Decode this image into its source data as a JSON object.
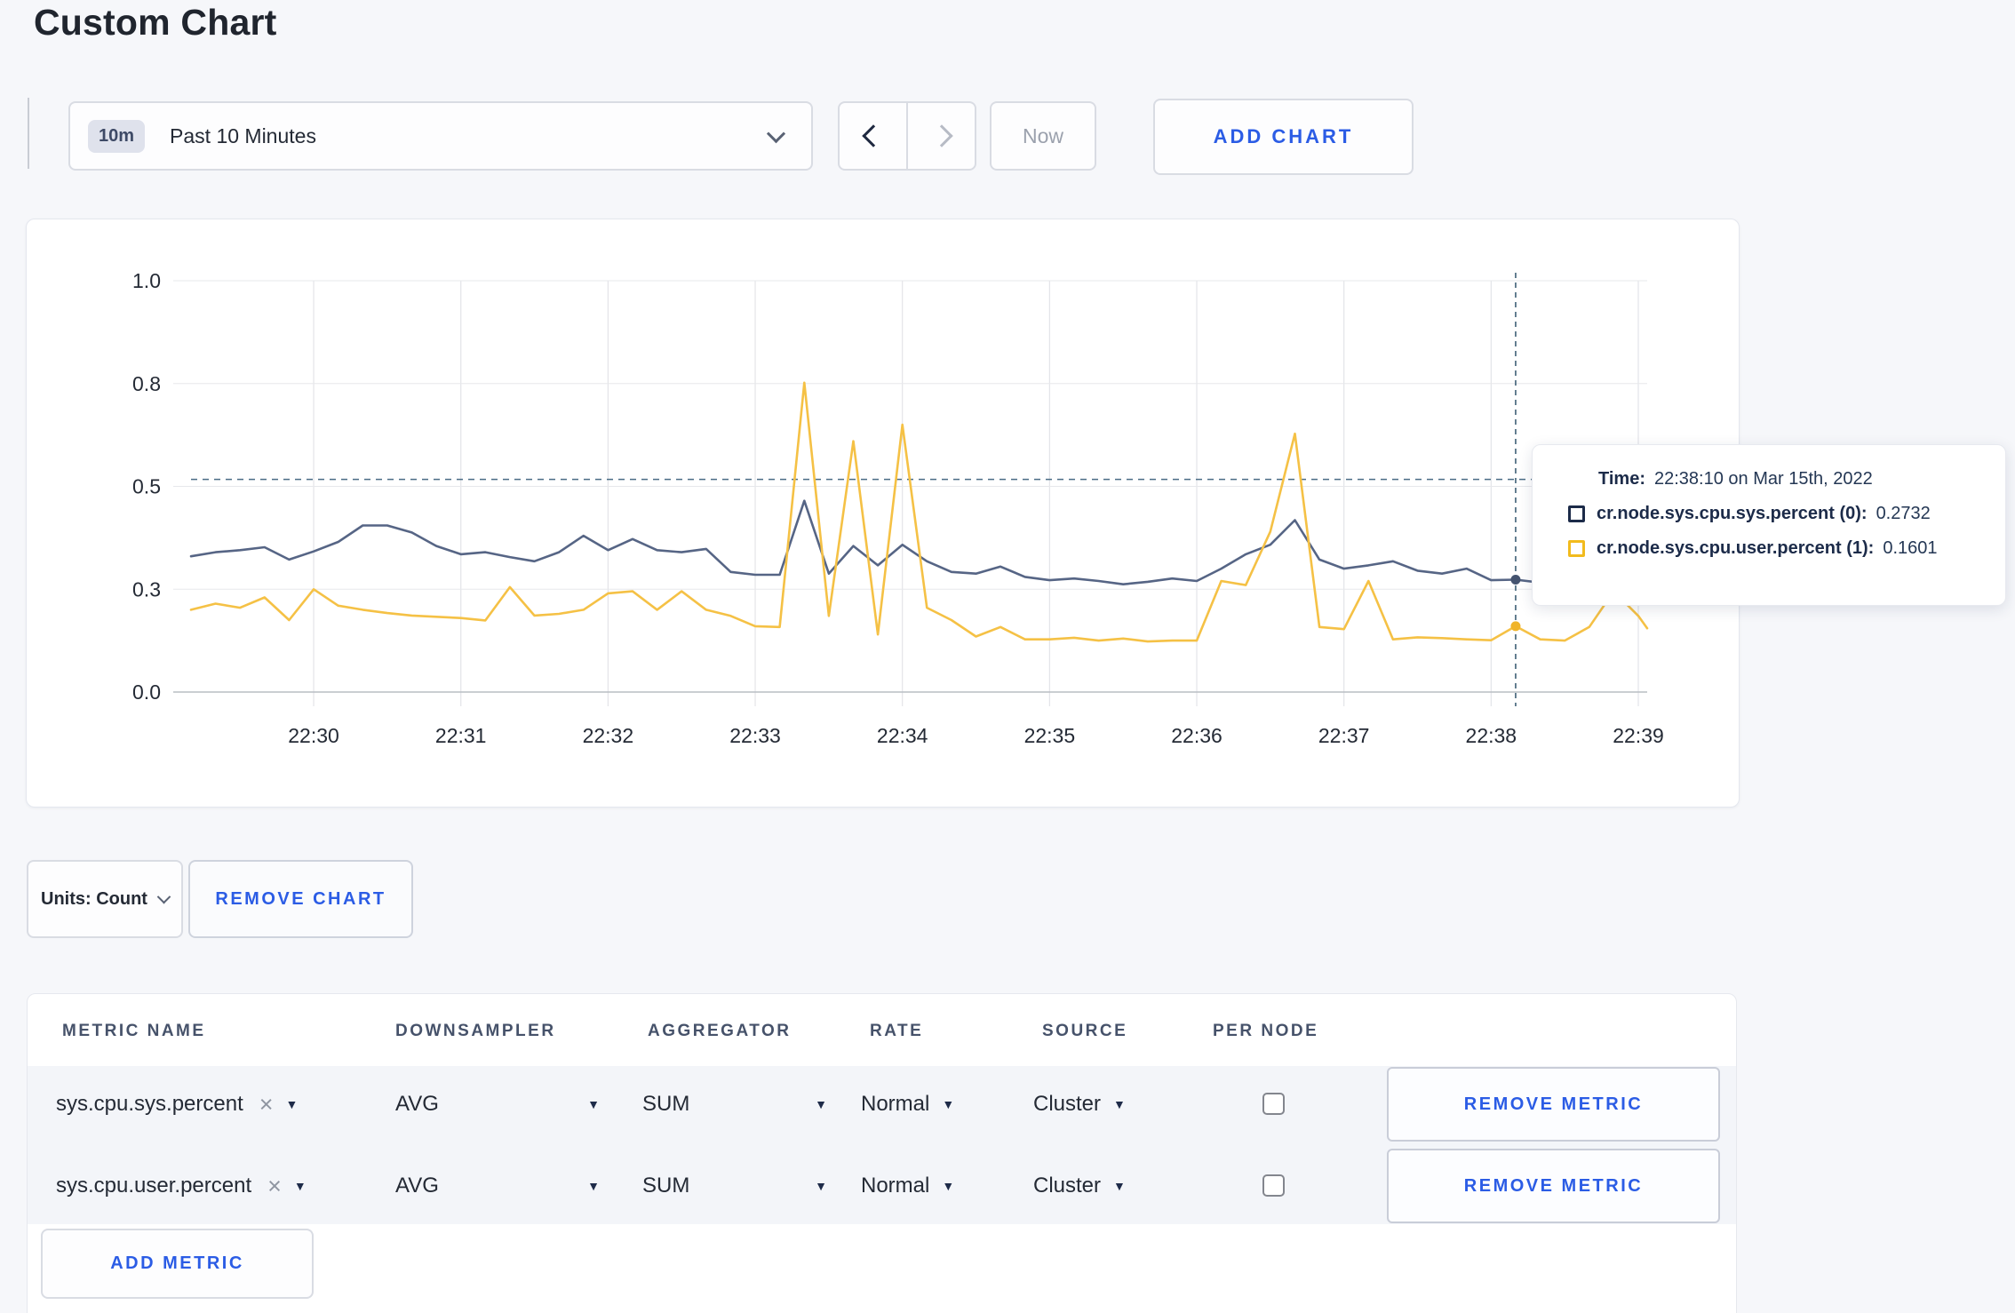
{
  "page": {
    "title": "Custom Chart",
    "background": "#f6f7fa"
  },
  "toolbar": {
    "time_badge": "10m",
    "time_label": "Past 10 Minutes",
    "now_label": "Now",
    "add_chart_label": "ADD CHART"
  },
  "chart_data": {
    "type": "line",
    "title": "",
    "xlabel": "",
    "ylabel": "",
    "ylim": [
      0,
      1
    ],
    "grid": true,
    "y_tick_labels": [
      "1.0",
      "0.8",
      "0.5",
      "0.3",
      "0.0"
    ],
    "y_tick_values": [
      1.0,
      0.75,
      0.5,
      0.25,
      0.0
    ],
    "x_tick_labels": [
      "22:30",
      "22:31",
      "22:32",
      "22:33",
      "22:34",
      "22:35",
      "22:36",
      "22:37",
      "22:38",
      "22:39"
    ],
    "x_start_time": "22:29:10",
    "x_interval_seconds": 10,
    "series": [
      {
        "name": "cr.node.sys.cpu.sys.percent",
        "color": "#566585",
        "dot_color": "#44536f",
        "values": [
          0.33,
          0.34,
          0.345,
          0.352,
          0.322,
          0.342,
          0.365,
          0.405,
          0.405,
          0.388,
          0.355,
          0.335,
          0.34,
          0.328,
          0.318,
          0.34,
          0.38,
          0.345,
          0.372,
          0.345,
          0.34,
          0.348,
          0.292,
          0.285,
          0.285,
          0.465,
          0.288,
          0.355,
          0.308,
          0.358,
          0.318,
          0.292,
          0.288,
          0.305,
          0.28,
          0.272,
          0.276,
          0.27,
          0.262,
          0.268,
          0.276,
          0.27,
          0.3,
          0.335,
          0.358,
          0.418,
          0.322,
          0.3,
          0.308,
          0.318,
          0.295,
          0.288,
          0.3,
          0.272,
          0.2732,
          0.266,
          0.26,
          0.262,
          0.26,
          0.26,
          0.258
        ]
      },
      {
        "name": "cr.node.sys.cpu.user.percent",
        "color": "#f5c145",
        "dot_color": "#f0b429",
        "values": [
          0.2,
          0.215,
          0.205,
          0.23,
          0.175,
          0.25,
          0.21,
          0.2,
          0.192,
          0.186,
          0.183,
          0.18,
          0.174,
          0.255,
          0.186,
          0.19,
          0.2,
          0.24,
          0.245,
          0.2,
          0.245,
          0.2,
          0.185,
          0.16,
          0.158,
          0.752,
          0.185,
          0.61,
          0.14,
          0.65,
          0.205,
          0.175,
          0.135,
          0.158,
          0.128,
          0.128,
          0.132,
          0.125,
          0.13,
          0.123,
          0.125,
          0.125,
          0.27,
          0.26,
          0.39,
          0.628,
          0.158,
          0.153,
          0.27,
          0.128,
          0.133,
          0.131,
          0.128,
          0.126,
          0.1601,
          0.128,
          0.125,
          0.158,
          0.245,
          0.185,
          0.155
        ]
      }
    ],
    "crosshair": {
      "index": 54,
      "hline_value": 0.517
    },
    "legend_position": "tooltip"
  },
  "tooltip": {
    "time_label": "Time:",
    "time_value": "22:38:10 on Mar 15th, 2022",
    "entries": [
      {
        "label": "cr.node.sys.cpu.sys.percent (0):",
        "value": "0.2732",
        "color": "#1c2b49"
      },
      {
        "label": "cr.node.sys.cpu.user.percent (1):",
        "value": "0.1601",
        "color": "#f2bb1d"
      }
    ]
  },
  "chart_controls": {
    "units_label": "Units: Count",
    "remove_chart_label": "REMOVE CHART"
  },
  "metrics_table": {
    "headers": [
      "METRIC NAME",
      "DOWNSAMPLER",
      "AGGREGATOR",
      "RATE",
      "SOURCE",
      "PER NODE"
    ],
    "rows": [
      {
        "metric": "sys.cpu.sys.percent",
        "clear_icon": "×",
        "downsampler": "AVG",
        "aggregator": "SUM",
        "rate": "Normal",
        "source": "Cluster",
        "per_node_checked": false,
        "remove_label": "REMOVE METRIC"
      },
      {
        "metric": "sys.cpu.user.percent",
        "clear_icon": "×",
        "downsampler": "AVG",
        "aggregator": "SUM",
        "rate": "Normal",
        "source": "Cluster",
        "per_node_checked": false,
        "remove_label": "REMOVE METRIC"
      }
    ],
    "add_metric_label": "ADD METRIC"
  },
  "colors": {
    "accent_blue": "#2b5ce5",
    "page_background": "#f6f7fa",
    "row_background": "#f3f5f9",
    "grid_line": "#e3e4e8",
    "axis_line": "#b9bdc4",
    "crosshair": "#3f6076"
  }
}
